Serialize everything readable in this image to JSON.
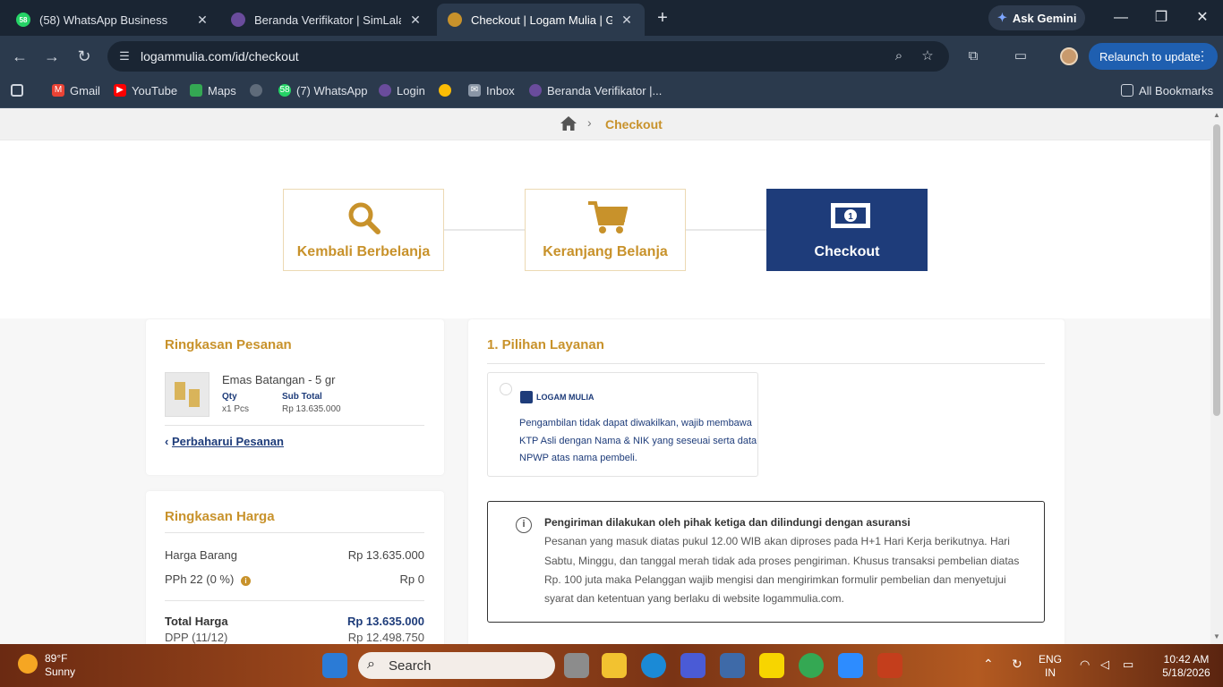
{
  "browser": {
    "tabs": [
      {
        "title": "(58) WhatsApp Business",
        "badge": "58",
        "active": false
      },
      {
        "title": "Beranda Verifikator | SimLala",
        "badge": "",
        "active": false
      },
      {
        "title": "Checkout | Logam Mulia | Gold",
        "badge": "",
        "active": true
      }
    ],
    "new_tab": "+",
    "ask_gemini": "Ask Gemini",
    "url": "logammulia.com/id/checkout",
    "relaunch": "Relaunch to update",
    "bookmarks": [
      {
        "label": "",
        "icon": "apps-grid-icon"
      },
      {
        "label": "Gmail",
        "icon": "gmail-icon"
      },
      {
        "label": "YouTube",
        "icon": "youtube-icon"
      },
      {
        "label": "Maps",
        "icon": "maps-icon"
      },
      {
        "label": "",
        "icon": "globe-icon"
      },
      {
        "label": "(7) WhatsApp",
        "icon": "whatsapp-icon"
      },
      {
        "label": "Login",
        "icon": "site-icon"
      },
      {
        "label": "",
        "icon": "pinwheel-icon"
      },
      {
        "label": "Inbox",
        "icon": "mail-icon"
      },
      {
        "label": "Beranda Verifikator |...",
        "icon": "site-icon"
      }
    ],
    "all_bookmarks": "All Bookmarks",
    "badge_58": "58"
  },
  "page": {
    "breadcrumb": {
      "current": "Checkout",
      "separator": "›"
    },
    "steps": [
      {
        "label": "Kembali Berbelanja",
        "icon": "search-icon",
        "active": false
      },
      {
        "label": "Keranjang Belanja",
        "icon": "cart-icon",
        "active": false
      },
      {
        "label": "Checkout",
        "icon": "money-icon",
        "active": true
      }
    ],
    "order_summary": {
      "title": "Ringkasan Pesanan",
      "product_name": "Emas Batangan - 5 gr",
      "qty_label": "Qty",
      "qty_value": "x1 Pcs",
      "subtotal_label": "Sub Total",
      "subtotal_value": "Rp 13.635.000",
      "update_link": "Perbaharui Pesanan",
      "update_chevron": "‹"
    },
    "price_summary": {
      "title": "Ringkasan Harga",
      "rows": [
        {
          "label": "Harga Barang",
          "value": "Rp 13.635.000"
        },
        {
          "label": "PPh 22 (0 %)",
          "value": "Rp 0"
        }
      ],
      "total_label": "Total Harga",
      "total_value": "Rp 13.635.000",
      "dpp_label": "DPP (11/12)",
      "dpp_value": "Rp 12.498.750"
    },
    "service": {
      "title": "1. Pilihan Layanan",
      "logo_text": "LOGAM MULIA",
      "option_text_1": "Pengambilan tidak dapat diwakilkan, wajib membawa",
      "option_text_2": "KTP Asli dengan Nama & NIK yang seseuai serta data",
      "option_text_3": "NPWP atas nama pembeli.",
      "notice_title": "Pengiriman dilakukan oleh pihak ketiga dan dilindungi dengan asuransi",
      "notice_lines": [
        "Pesanan yang masuk diatas pukul 12.00 WIB akan diproses pada H+1 Hari Kerja berikutnya. Hari",
        "Sabtu, Minggu, dan tanggal merah tidak ada proses pengiriman. Khusus transaksi pembelian diatas",
        "Rp. 100 juta maka Pelanggan wajib mengisi dan mengirimkan formulir pembelian dan menyetujui",
        "syarat dan ketentuan yang berlaku di website logammulia.com."
      ]
    }
  },
  "taskbar": {
    "temp": "89°F",
    "weather": "Sunny",
    "search_placeholder": "Search",
    "lang_1": "ENG",
    "lang_2": "IN",
    "time": "10:42 AM",
    "date": "5/18/2026"
  },
  "colors": {
    "gold": "#c8922b",
    "navy": "#1e3c7a",
    "chrome_dark": "#1f2a3a"
  }
}
